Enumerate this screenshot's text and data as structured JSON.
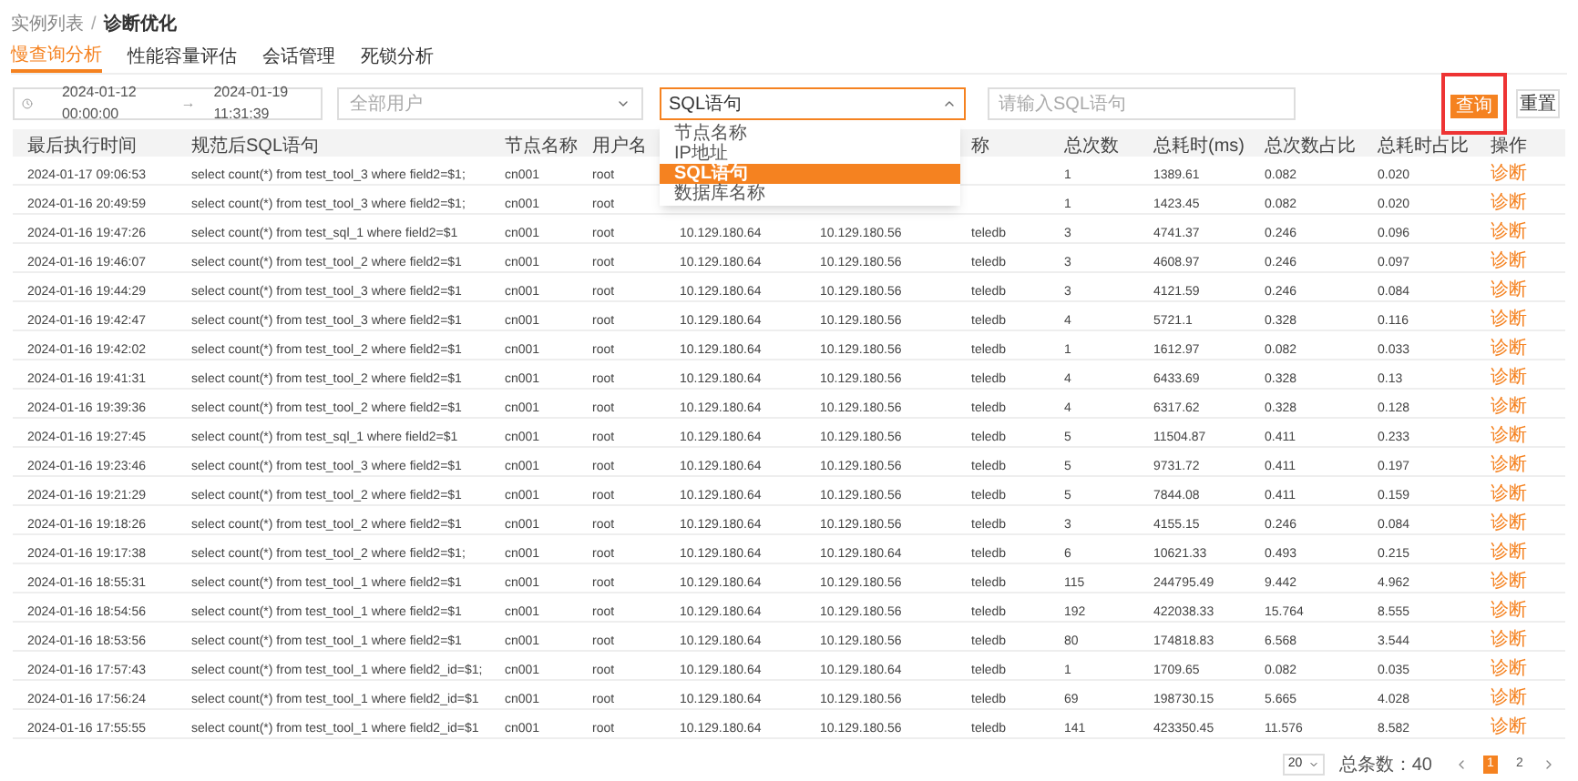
{
  "breadcrumb": {
    "parent": "实例列表",
    "separator": "/",
    "current": "诊断优化"
  },
  "tabs": [
    {
      "label": "慢查询分析",
      "selected": true
    },
    {
      "label": "性能容量评估",
      "selected": false
    },
    {
      "label": "会话管理",
      "selected": false
    },
    {
      "label": "死锁分析",
      "selected": false
    }
  ],
  "filters": {
    "date_start": "2024-01-12 00:00:00",
    "date_separator": "→",
    "date_end": "2024-01-19 11:31:39",
    "user_select": {
      "placeholder": "全部用户"
    },
    "field_select": {
      "value": "SQL语句",
      "expanded": true,
      "options": [
        {
          "label": "节点名称",
          "selected": false
        },
        {
          "label": "IP地址",
          "selected": false
        },
        {
          "label": "SQL语句",
          "selected": true
        },
        {
          "label": "数据库名称",
          "selected": false
        }
      ]
    },
    "search": {
      "placeholder": "请输入SQL语句"
    },
    "query_button": "查询",
    "reset_button": "重置"
  },
  "table": {
    "columns": [
      "最后执行时间",
      "规范后SQL语句",
      "节点名称",
      "用户名",
      null,
      null,
      "称",
      "总次数",
      "总耗时(ms)",
      "总次数占比",
      "总耗时占比",
      "操作"
    ],
    "rows": [
      [
        "2024-01-17 09:06:53",
        "select count(*) from test_tool_3 where field2=$1;",
        "cn001",
        "root",
        null,
        null,
        null,
        "1",
        "1389.61",
        "0.082",
        "0.020",
        "诊断"
      ],
      [
        "2024-01-16 20:49:59",
        "select count(*) from test_tool_3 where field2=$1;",
        "cn001",
        "root",
        null,
        null,
        null,
        "1",
        "1423.45",
        "0.082",
        "0.020",
        "诊断"
      ],
      [
        "2024-01-16 19:47:26",
        "select count(*) from test_sql_1 where field2=$1",
        "cn001",
        "root",
        "10.129.180.64",
        "10.129.180.56",
        "teledb",
        "3",
        "4741.37",
        "0.246",
        "0.096",
        "诊断"
      ],
      [
        "2024-01-16 19:46:07",
        "select count(*) from test_tool_2 where field2=$1",
        "cn001",
        "root",
        "10.129.180.64",
        "10.129.180.56",
        "teledb",
        "3",
        "4608.97",
        "0.246",
        "0.097",
        "诊断"
      ],
      [
        "2024-01-16 19:44:29",
        "select count(*) from test_tool_3 where field2=$1",
        "cn001",
        "root",
        "10.129.180.64",
        "10.129.180.56",
        "teledb",
        "3",
        "4121.59",
        "0.246",
        "0.084",
        "诊断"
      ],
      [
        "2024-01-16 19:42:47",
        "select count(*) from test_tool_3 where field2=$1",
        "cn001",
        "root",
        "10.129.180.64",
        "10.129.180.56",
        "teledb",
        "4",
        "5721.1",
        "0.328",
        "0.116",
        "诊断"
      ],
      [
        "2024-01-16 19:42:02",
        "select count(*) from test_tool_2 where field2=$1",
        "cn001",
        "root",
        "10.129.180.64",
        "10.129.180.56",
        "teledb",
        "1",
        "1612.97",
        "0.082",
        "0.033",
        "诊断"
      ],
      [
        "2024-01-16 19:41:31",
        "select count(*) from test_tool_2 where field2=$1",
        "cn001",
        "root",
        "10.129.180.64",
        "10.129.180.56",
        "teledb",
        "4",
        "6433.69",
        "0.328",
        "0.13",
        "诊断"
      ],
      [
        "2024-01-16 19:39:36",
        "select count(*) from test_tool_2 where field2=$1",
        "cn001",
        "root",
        "10.129.180.64",
        "10.129.180.56",
        "teledb",
        "4",
        "6317.62",
        "0.328",
        "0.128",
        "诊断"
      ],
      [
        "2024-01-16 19:27:45",
        "select count(*) from test_sql_1 where field2=$1",
        "cn001",
        "root",
        "10.129.180.64",
        "10.129.180.56",
        "teledb",
        "5",
        "11504.87",
        "0.411",
        "0.233",
        "诊断"
      ],
      [
        "2024-01-16 19:23:46",
        "select count(*) from test_tool_3 where field2=$1",
        "cn001",
        "root",
        "10.129.180.64",
        "10.129.180.56",
        "teledb",
        "5",
        "9731.72",
        "0.411",
        "0.197",
        "诊断"
      ],
      [
        "2024-01-16 19:21:29",
        "select count(*) from test_tool_2 where field2=$1",
        "cn001",
        "root",
        "10.129.180.64",
        "10.129.180.56",
        "teledb",
        "5",
        "7844.08",
        "0.411",
        "0.159",
        "诊断"
      ],
      [
        "2024-01-16 19:18:26",
        "select count(*) from test_tool_2 where field2=$1",
        "cn001",
        "root",
        "10.129.180.64",
        "10.129.180.56",
        "teledb",
        "3",
        "4155.15",
        "0.246",
        "0.084",
        "诊断"
      ],
      [
        "2024-01-16 19:17:38",
        "select count(*) from test_tool_2 where field2=$1;",
        "cn001",
        "root",
        "10.129.180.64",
        "10.129.180.64",
        "teledb",
        "6",
        "10621.33",
        "0.493",
        "0.215",
        "诊断"
      ],
      [
        "2024-01-16 18:55:31",
        "select count(*) from test_tool_1 where field2=$1",
        "cn001",
        "root",
        "10.129.180.64",
        "10.129.180.56",
        "teledb",
        "115",
        "244795.49",
        "9.442",
        "4.962",
        "诊断"
      ],
      [
        "2024-01-16 18:54:56",
        "select count(*) from test_tool_1 where field2=$1",
        "cn001",
        "root",
        "10.129.180.64",
        "10.129.180.56",
        "teledb",
        "192",
        "422038.33",
        "15.764",
        "8.555",
        "诊断"
      ],
      [
        "2024-01-16 18:53:56",
        "select count(*) from test_tool_1 where field2=$1",
        "cn001",
        "root",
        "10.129.180.64",
        "10.129.180.56",
        "teledb",
        "80",
        "174818.83",
        "6.568",
        "3.544",
        "诊断"
      ],
      [
        "2024-01-16 17:57:43",
        "select count(*) from test_tool_1 where field2_id=$1;",
        "cn001",
        "root",
        "10.129.180.64",
        "10.129.180.64",
        "teledb",
        "1",
        "1709.65",
        "0.082",
        "0.035",
        "诊断"
      ],
      [
        "2024-01-16 17:56:24",
        "select count(*) from test_tool_1 where field2_id=$1",
        "cn001",
        "root",
        "10.129.180.64",
        "10.129.180.56",
        "teledb",
        "69",
        "198730.15",
        "5.665",
        "4.028",
        "诊断"
      ],
      [
        "2024-01-16 17:55:55",
        "select count(*) from test_tool_1 where field2_id=$1",
        "cn001",
        "root",
        "10.129.180.64",
        "10.129.180.56",
        "teledb",
        "141",
        "423350.45",
        "11.576",
        "8.582",
        "诊断"
      ]
    ]
  },
  "pagination": {
    "page_size": "20",
    "total": "总条数：40",
    "pages": [
      {
        "label": "1",
        "selected": true
      },
      {
        "label": "2",
        "selected": false
      }
    ]
  }
}
